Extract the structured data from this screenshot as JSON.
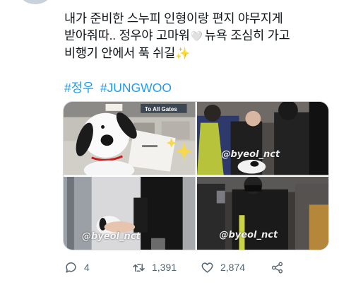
{
  "tweet": {
    "text_lines": [
      "내가 준비한 스누피 인형이랑 편지 야무지게",
      "받아줘따.. 정우야 고마워",
      "뉴욕 조심히 가고",
      "비행기 안에서 푹 쉬길"
    ],
    "heart_emoji": "🤍",
    "sparkle_emoji": "✨",
    "hashtags": [
      "#정우",
      "#JUNGWOO"
    ]
  },
  "media": {
    "sign_text": "To All Gates",
    "watermark": "@byeol_nct"
  },
  "actions": {
    "reply_count": "4",
    "retweet_count": "1,391",
    "like_count": "2,874"
  },
  "icons": {
    "reply": "reply-icon",
    "retweet": "retweet-icon",
    "like": "heart-icon",
    "share": "share-icon"
  },
  "colors": {
    "text": "#0f1419",
    "link": "#1d9bf0",
    "muted": "#536471",
    "border": "#cfd9de"
  }
}
